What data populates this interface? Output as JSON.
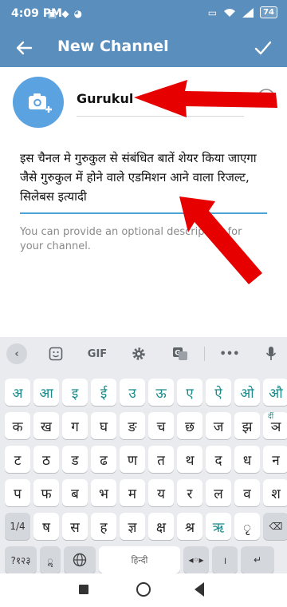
{
  "status": {
    "time": "4:09 PM",
    "left_icons": [
      "photo-icon",
      "location-icon",
      "app-icon"
    ],
    "right_icons": [
      "sim-icon",
      "wifi-icon",
      "signal-icon"
    ],
    "battery": "74"
  },
  "appbar": {
    "title": "New Channel",
    "back_icon": "arrow-left-icon",
    "confirm_icon": "check-icon",
    "color": "#5a8ebc"
  },
  "channel": {
    "avatar_icon": "camera-add-icon",
    "name": "Gurukul",
    "description": "इस चैनल मे गुरुकुल से संबंधित बातें शेयर किया जाएगा जैसे गुरुकुल में होने वाले एडमिशन आने वाला रिजल्ट, सिलेबस इत्यादी",
    "hint": "You can provide an optional description for your channel."
  },
  "keyboard": {
    "toolbar": [
      "<",
      "sticker-icon",
      "GIF",
      "gear-icon",
      "translate-icon",
      "•••",
      "mic-icon"
    ],
    "row1": [
      "अ",
      "आ",
      "इ",
      "ई",
      "उ",
      "ऊ",
      "ए",
      "ऐ",
      "ओ",
      "औ"
    ],
    "row2": [
      "क",
      "ख",
      "ग",
      "घ",
      "ङ",
      "च",
      "छ",
      "ज",
      "झ",
      "ञ"
    ],
    "row3": [
      "ट",
      "ठ",
      "ड",
      "ढ",
      "ण",
      "त",
      "थ",
      "द",
      "ध",
      "न"
    ],
    "row4": [
      "प",
      "फ",
      "ब",
      "भ",
      "म",
      "य",
      "र",
      "ल",
      "व",
      "श"
    ],
    "row5": [
      "1/4",
      "ष",
      "स",
      "ह",
      "ज्ञ",
      "क्ष",
      "श्र",
      "ऋ",
      "ृ",
      "⌫"
    ],
    "row6": [
      "?१२३",
      "ॢ",
      "globe-icon",
      "हिन्दी",
      "◂◦▸",
      "।",
      "↵"
    ],
    "row2_last_hint": "दीं",
    "accent": "#1a8a8a"
  },
  "annotation": {
    "arrow_color": "#e60000"
  }
}
